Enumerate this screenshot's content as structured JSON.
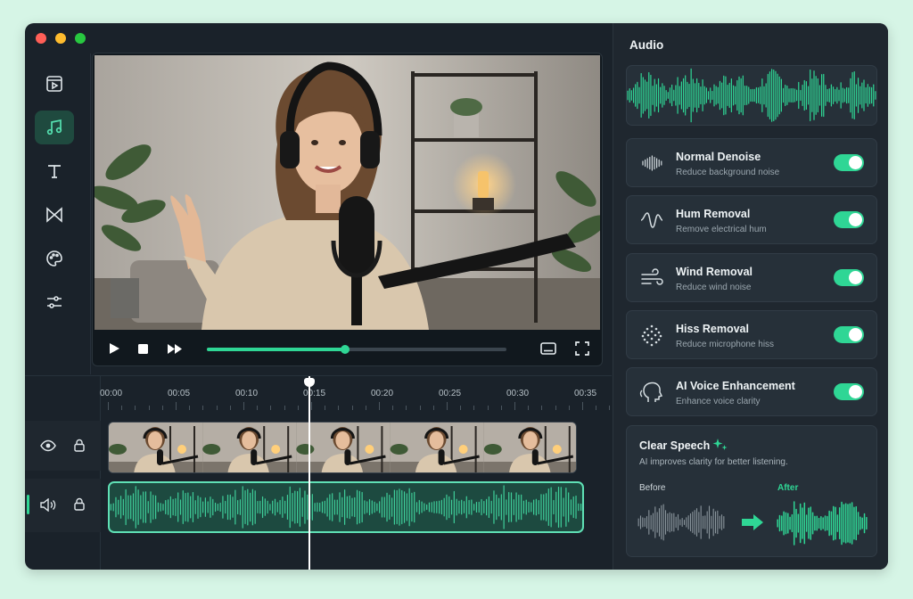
{
  "rail": {
    "items": [
      {
        "name": "media",
        "icon": "media-icon",
        "active": false
      },
      {
        "name": "audio",
        "icon": "music-note-icon",
        "active": true
      },
      {
        "name": "text",
        "icon": "text-icon",
        "active": false
      },
      {
        "name": "transitions",
        "icon": "bowtie-icon",
        "active": false
      },
      {
        "name": "effects",
        "icon": "palette-icon",
        "active": false
      },
      {
        "name": "adjust",
        "icon": "sliders-icon",
        "active": false
      }
    ]
  },
  "player": {
    "progress": 0.46
  },
  "timeline": {
    "ruler": [
      "00:00",
      "00:05",
      "00:10",
      "00:15",
      "00:20",
      "00:25",
      "00:30",
      "00:35"
    ],
    "playhead_time": "00:13"
  },
  "audio_panel": {
    "title": "Audio",
    "features": [
      {
        "title": "Normal Denoise",
        "subtitle": "Reduce background noise",
        "icon": "denoise-icon",
        "enabled": true
      },
      {
        "title": "Hum Removal",
        "subtitle": "Remove electrical hum",
        "icon": "hum-icon",
        "enabled": true
      },
      {
        "title": "Wind Removal",
        "subtitle": "Reduce wind noise",
        "icon": "wind-icon",
        "enabled": true
      },
      {
        "title": "Hiss Removal",
        "subtitle": "Reduce microphone hiss",
        "icon": "hiss-icon",
        "enabled": true
      },
      {
        "title": "AI Voice Enhancement",
        "subtitle": "Enhance voice clarity",
        "icon": "ai-head-icon",
        "enabled": true
      }
    ],
    "clear_speech": {
      "title": "Clear Speech",
      "subtitle": "AI improves clarity for better listening.",
      "before_label": "Before",
      "after_label": "After"
    }
  },
  "colors": {
    "accent": "#2fd695",
    "panel": "#1f272f",
    "window": "#1a222a"
  }
}
